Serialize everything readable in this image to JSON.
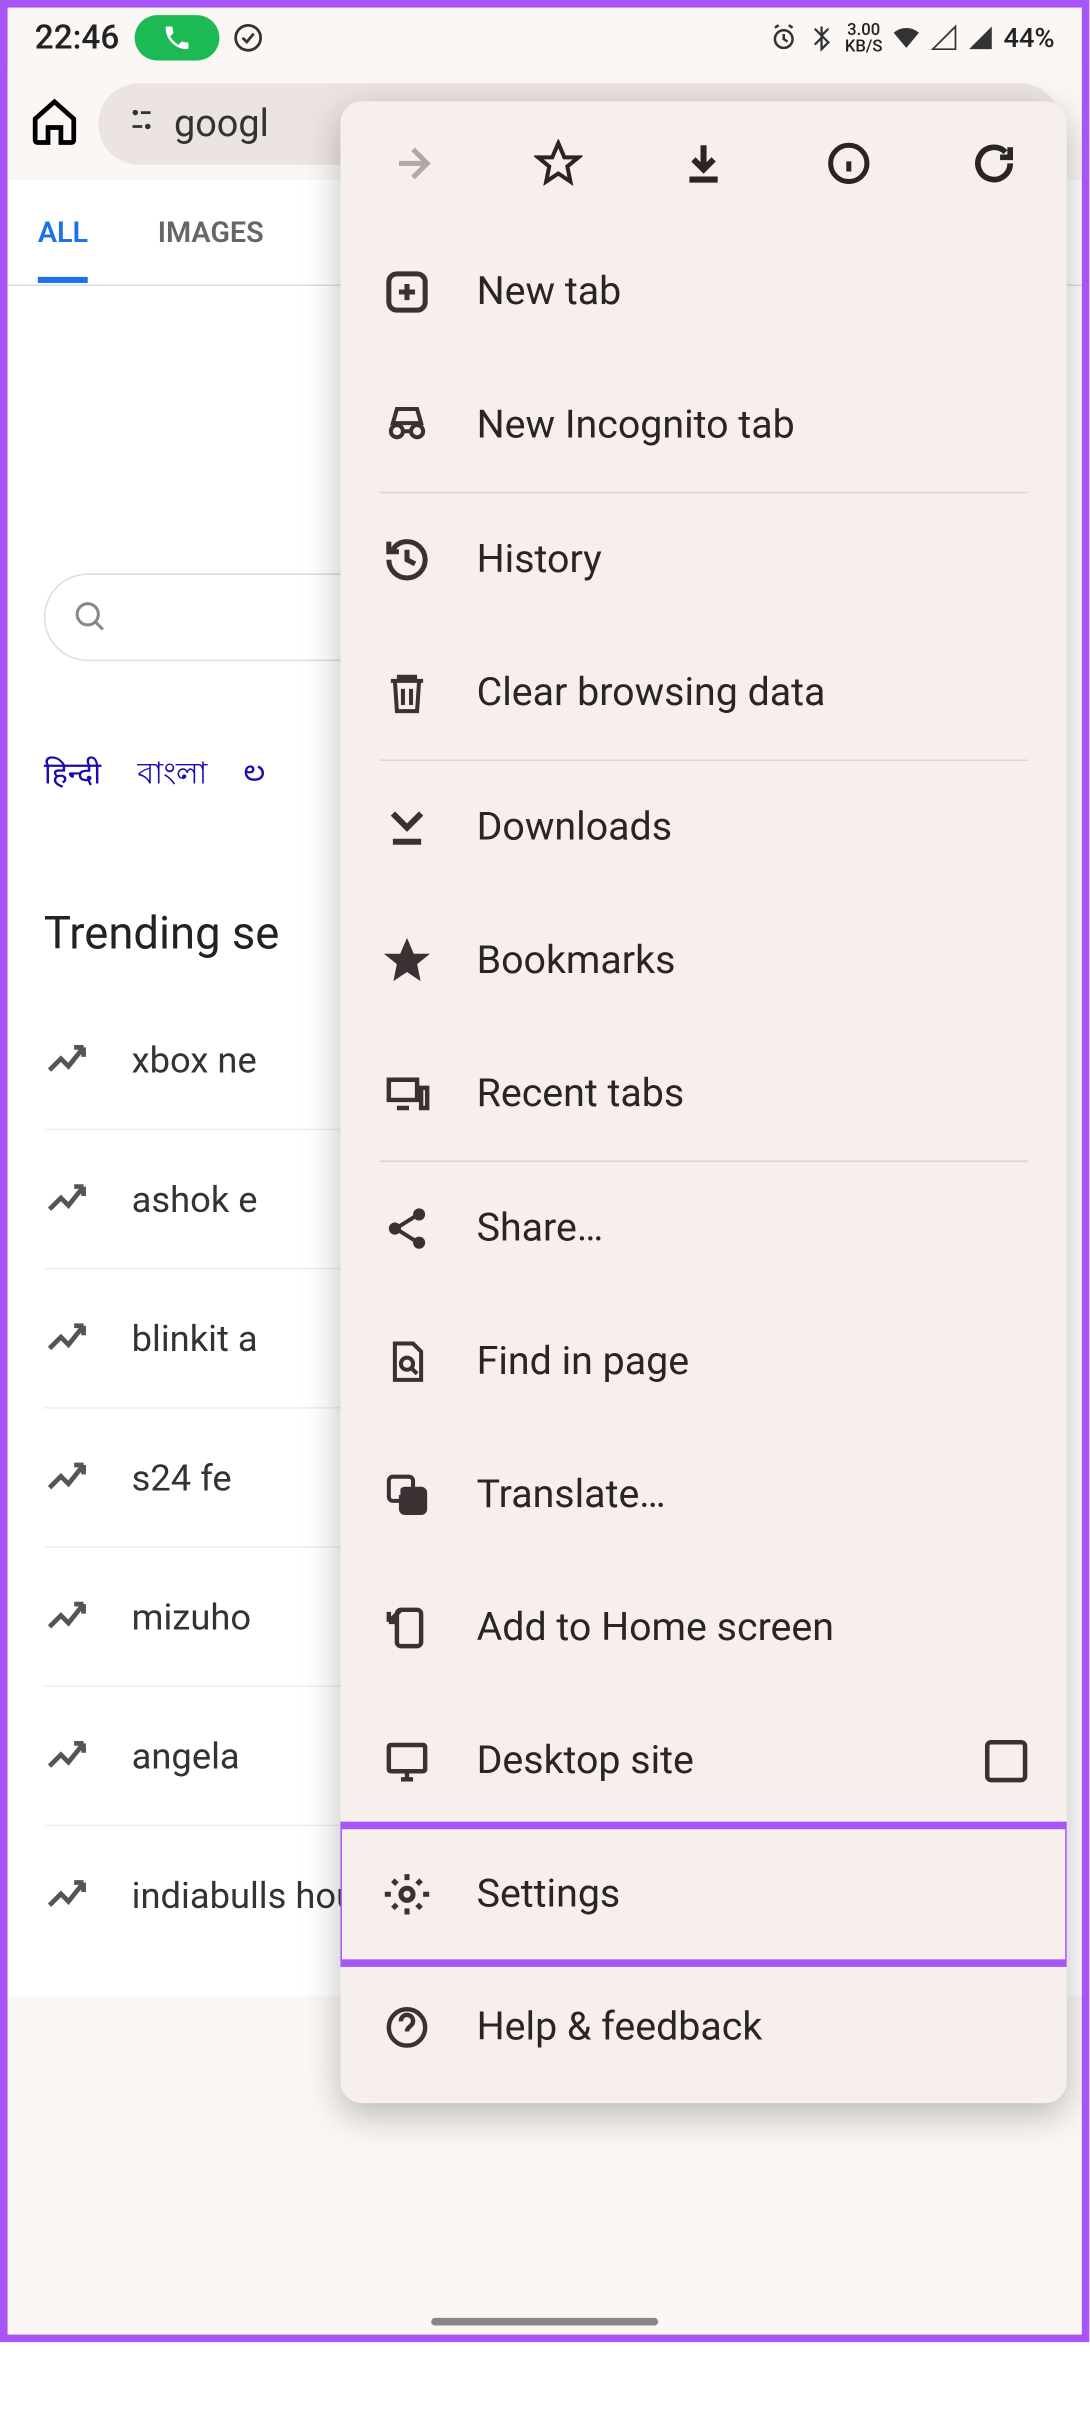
{
  "status": {
    "time": "22:46",
    "kbps": "3.00",
    "kbps_unit": "KB/S",
    "battery": "44%"
  },
  "toolbar": {
    "url": "googl"
  },
  "tabs": {
    "all": "ALL",
    "images": "IMAGES"
  },
  "langs": [
    "हिन्दी",
    "বাংলা",
    "ల"
  ],
  "trending_header": "Trending se",
  "trending": [
    "xbox ne",
    "ashok e",
    "blinkit a",
    "s24 fe",
    "mizuho",
    "angela",
    "indiabulls housing finance"
  ],
  "menu": {
    "new_tab": "New tab",
    "incognito": "New Incognito tab",
    "history": "History",
    "clear": "Clear browsing data",
    "downloads": "Downloads",
    "bookmarks": "Bookmarks",
    "recent": "Recent tabs",
    "share": "Share…",
    "find": "Find in page",
    "translate": "Translate…",
    "addhome": "Add to Home screen",
    "desktop": "Desktop site",
    "settings": "Settings",
    "help": "Help & feedback"
  }
}
